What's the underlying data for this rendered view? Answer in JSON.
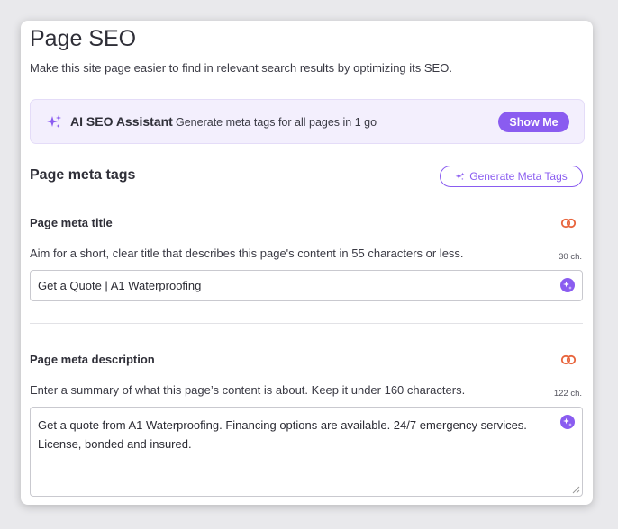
{
  "page": {
    "title": "Page SEO",
    "subtitle": "Make this site page easier to find in relevant search results by optimizing its SEO."
  },
  "ai_assistant": {
    "icon": "sparkles-icon",
    "title": "AI SEO Assistant",
    "description": "Generate meta tags for all pages in 1 go",
    "button_label": "Show Me"
  },
  "meta_tags": {
    "section_title": "Page meta tags",
    "generate_button_label": "Generate Meta Tags",
    "title_field": {
      "label": "Page meta title",
      "helper": "Aim for a short, clear title that describes this page's content in 55 characters or less.",
      "char_count": "30 ch.",
      "value": "Get a Quote | A1 Waterproofing",
      "link_icon": "link-icon",
      "ai_icon": "ai-sparkle-icon"
    },
    "description_field": {
      "label": "Page meta description",
      "helper": "Enter a summary of what this page’s content is about. Keep it under 160 characters.",
      "char_count": "122 ch.",
      "value": "Get a quote from A1 Waterproofing. Financing options are available. 24/7 emergency services. License, bonded and insured.",
      "link_icon": "link-icon",
      "ai_icon": "ai-sparkle-icon"
    }
  },
  "colors": {
    "accent": "#8a5cf0",
    "banner_bg": "#f3effd",
    "link_icon": "#e8643c"
  }
}
